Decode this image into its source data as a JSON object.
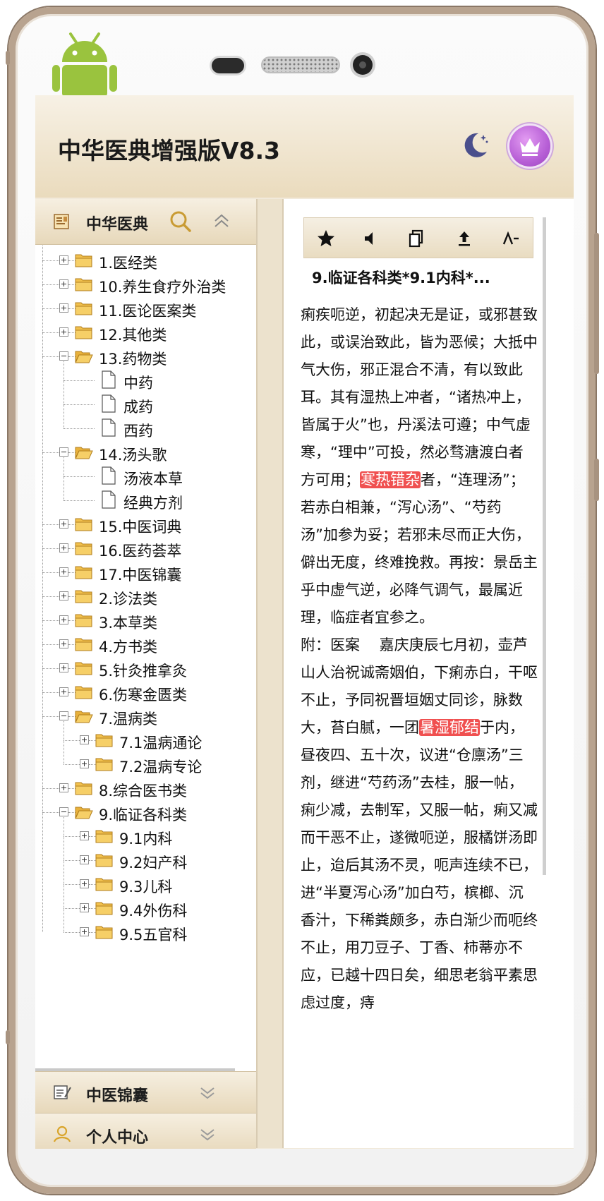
{
  "app": {
    "title": "中华医典增强版V8.3"
  },
  "left_panel": {
    "header_label": "中华医典",
    "tree": [
      {
        "label": "1.医经类",
        "level": 0,
        "type": "folder",
        "state": "collapsed"
      },
      {
        "label": "10.养生食疗外治类",
        "level": 0,
        "type": "folder",
        "state": "collapsed"
      },
      {
        "label": "11.医论医案类",
        "level": 0,
        "type": "folder",
        "state": "collapsed"
      },
      {
        "label": "12.其他类",
        "level": 0,
        "type": "folder",
        "state": "collapsed"
      },
      {
        "label": "13.药物类",
        "level": 0,
        "type": "folder",
        "state": "expanded"
      },
      {
        "label": "中药",
        "level": 1,
        "type": "doc"
      },
      {
        "label": "成药",
        "level": 1,
        "type": "doc"
      },
      {
        "label": "西药",
        "level": 1,
        "type": "doc"
      },
      {
        "label": "14.汤头歌",
        "level": 0,
        "type": "folder",
        "state": "expanded"
      },
      {
        "label": "汤液本草",
        "level": 1,
        "type": "doc"
      },
      {
        "label": "经典方剂",
        "level": 1,
        "type": "doc"
      },
      {
        "label": "15.中医词典",
        "level": 0,
        "type": "folder",
        "state": "collapsed"
      },
      {
        "label": "16.医药荟萃",
        "level": 0,
        "type": "folder",
        "state": "collapsed"
      },
      {
        "label": "17.中医锦囊",
        "level": 0,
        "type": "folder",
        "state": "collapsed"
      },
      {
        "label": "2.诊法类",
        "level": 0,
        "type": "folder",
        "state": "collapsed"
      },
      {
        "label": "3.本草类",
        "level": 0,
        "type": "folder",
        "state": "collapsed"
      },
      {
        "label": "4.方书类",
        "level": 0,
        "type": "folder",
        "state": "collapsed"
      },
      {
        "label": "5.针灸推拿灸",
        "level": 0,
        "type": "folder",
        "state": "collapsed"
      },
      {
        "label": "6.伤寒金匮类",
        "level": 0,
        "type": "folder",
        "state": "collapsed"
      },
      {
        "label": "7.温病类",
        "level": 0,
        "type": "folder",
        "state": "expanded"
      },
      {
        "label": "7.1温病通论",
        "level": 1,
        "type": "folder",
        "state": "collapsed"
      },
      {
        "label": "7.2温病专论",
        "level": 1,
        "type": "folder",
        "state": "collapsed"
      },
      {
        "label": "8.综合医书类",
        "level": 0,
        "type": "folder",
        "state": "collapsed"
      },
      {
        "label": "9.临证各科类",
        "level": 0,
        "type": "folder",
        "state": "expanded"
      },
      {
        "label": "9.1内科",
        "level": 1,
        "type": "folder",
        "state": "collapsed"
      },
      {
        "label": "9.2妇产科",
        "level": 1,
        "type": "folder",
        "state": "collapsed"
      },
      {
        "label": "9.3儿科",
        "level": 1,
        "type": "folder",
        "state": "collapsed"
      },
      {
        "label": "9.4外伤科",
        "level": 1,
        "type": "folder",
        "state": "collapsed"
      },
      {
        "label": "9.5五官科",
        "level": 1,
        "type": "folder",
        "state": "collapsed"
      }
    ],
    "accordion": [
      {
        "label": "中医锦囊"
      },
      {
        "label": "个人中心"
      }
    ]
  },
  "right_panel": {
    "title": "9.临证各科类*9.1内科*...",
    "paragraphs": [
      [
        {
          "t": "痢疾呃逆，初起决无是证，或邪甚致此，或误治致此，皆为恶候；大抵中气大伤，邪正混合不清，有以致此耳。其有湿热上冲者，“诸热冲上，皆属于火”也，丹溪法可遵；中气虚寒，“理中”可投，然必骛溏渡白者方可用；"
        },
        {
          "t": "寒热错杂",
          "hl": true
        },
        {
          "t": "者，“连理汤”；若赤白相兼，“泻心汤”、“芍药汤”加参为妥；若邪未尽而正大伤，僻出无度，终难挽救。再按：景岳主乎中虚气逆，必降气调气，最属近理，临症者宜参之。"
        }
      ],
      [
        {
          "t": "附：医案　 嘉庆庚辰七月初，壶芦山人治祝诚斋姻伯，下痢赤白，干呕不止，予同祝晋垣姻丈同诊，脉数大，苔白腻，一团"
        },
        {
          "t": "暑湿郁结",
          "hl": true
        },
        {
          "t": "于内，昼夜四、五十次，议进“仓廪汤”三剂，继进“芍药汤”去桂，服一帖，痢少减，去制军，又服一帖，痢又减而干恶不止，遂微呃逆，服橘饼汤即止，迨后其汤不灵，呃声连续不已，进“半夏泻心汤”加白芍，槟榔、沉香汁，下稀粪颇多，赤白渐少而呃终不止，用刀豆子、丁香、柿蒂亦不应，已越十四日矣，细思老翁平素思虑过度，痔"
        }
      ]
    ]
  },
  "icons": {
    "toolbar": [
      "star-icon",
      "volume-icon",
      "copy-icon",
      "share-icon",
      "font-size-icon"
    ],
    "header": [
      "night-mode-icon",
      "vip-crown-icon"
    ]
  },
  "colors": {
    "accent": "#eadbbd",
    "highlight": "#f05050",
    "folder": "#f2c14e"
  }
}
